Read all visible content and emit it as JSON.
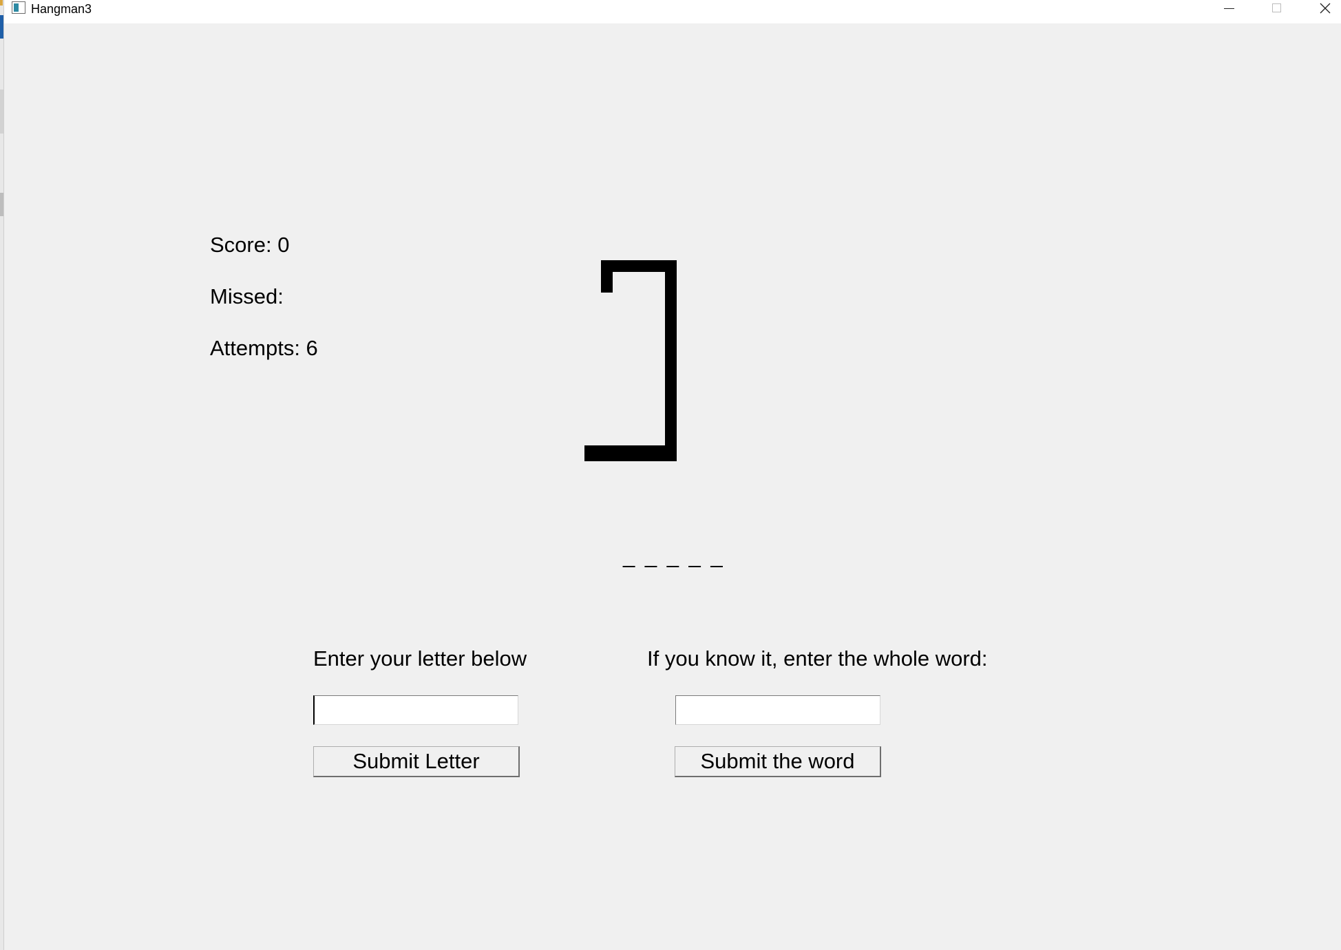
{
  "window": {
    "title": "Hangman3",
    "controls": {
      "minimize": "minimize-icon",
      "maximize": "maximize-icon",
      "close": "close-icon"
    }
  },
  "status": {
    "score_text": "Score: 0",
    "missed_text": "Missed:",
    "attempts_text": "Attempts: 6"
  },
  "game": {
    "word_mask": "_ _ _ _ _",
    "gallows_icon": "gallows-icon"
  },
  "letter_entry": {
    "label": "Enter your letter below",
    "value": "",
    "placeholder": "",
    "button_label": "Submit Letter"
  },
  "word_entry": {
    "label": "If you know it, enter the whole word:",
    "value": "",
    "placeholder": "",
    "button_label": "Submit the word"
  },
  "colors": {
    "background": "#f0f0f0",
    "titlebar": "#ffffff",
    "ink": "#000000"
  }
}
